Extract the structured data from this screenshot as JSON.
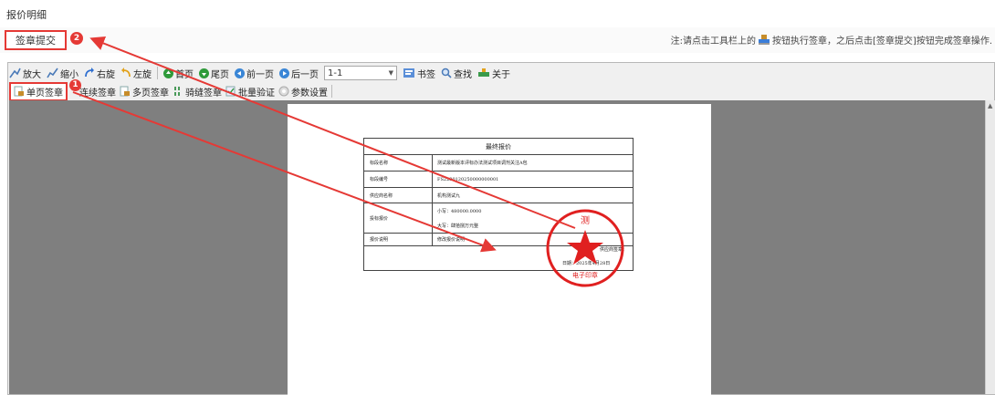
{
  "page": {
    "title": "报价明细"
  },
  "action_bar": {
    "sign_submit": "签章提交",
    "note": "注:请点击工具栏上的",
    "note_tail": "按钮执行签章，之后点击[签章提交]按钮完成签章操作."
  },
  "badges": {
    "one": "1",
    "two": "2"
  },
  "toolbar1": {
    "zoom_in": "放大",
    "zoom_out": "缩小",
    "rotate_right": "右旋",
    "rotate_left": "左旋",
    "first_page": "首页",
    "last_page": "尾页",
    "prev_page": "前一页",
    "next_page": "后一页",
    "page_value": "1-1",
    "bookmark": "书签",
    "find": "查找",
    "about": "关于"
  },
  "toolbar2": {
    "single_sign": "单页签章",
    "continuous_sign": "连续签章",
    "multi_sign": "多页签章",
    "seam_sign": "骑缝签章",
    "batch_verify": "批量验证",
    "settings": "参数设置"
  },
  "document": {
    "title": "最终报价",
    "rows": [
      {
        "label": "标段名称",
        "value": "测试最新版本评标办法测试项目调剂关注A包"
      },
      {
        "label": "标段编号",
        "value": "FS2230120250000000001"
      },
      {
        "label": "供应商名称",
        "value": "机构测试九"
      },
      {
        "label": "投标报价",
        "value": "小写：480000.0000",
        "value2": "大写：肆拾捌万元整"
      },
      {
        "label": "报价说明",
        "value": "修改报价说明"
      }
    ],
    "supplier_sign": "供应商签章：",
    "date": "日期：2025年4月28日"
  },
  "seal": {
    "top_text": "测",
    "bottom_text": "电子印章"
  },
  "colors": {
    "accent": "#e53935",
    "viewer_bg": "#7f7f7f"
  }
}
